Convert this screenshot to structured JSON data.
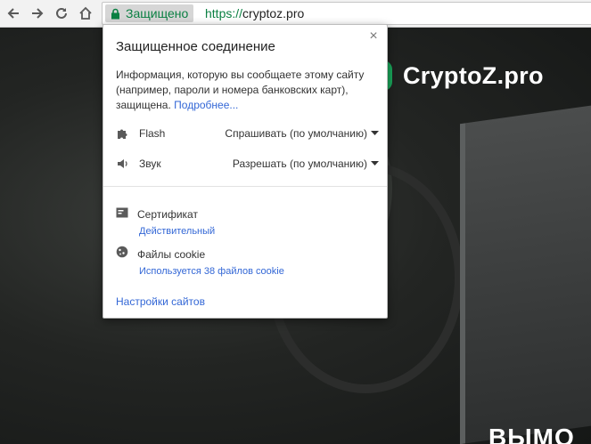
{
  "toolbar": {
    "secure_label": "Защищено",
    "url_scheme": "https://",
    "url_host": "cryptoz.pro"
  },
  "page": {
    "logo_text": "CryptoZ.pro",
    "hero_text": "ВЫМО"
  },
  "popup": {
    "title": "Защищенное соединение",
    "close_glyph": "×",
    "description": "Информация, которую вы сообщаете этому сайту (например, пароли и номера банковских карт), защищена.",
    "more_link": "Подробнее...",
    "permissions": [
      {
        "name": "Flash",
        "value": "Спрашивать (по умолчанию)"
      },
      {
        "name": "Звук",
        "value": "Разрешать (по умолчанию)"
      }
    ],
    "certificate": {
      "label": "Сертификат",
      "status": "Действительный"
    },
    "cookies": {
      "label": "Файлы cookie",
      "status": "Используется 38 файлов cookie"
    },
    "site_settings": "Настройки сайтов"
  },
  "colors": {
    "secure_green": "#0b8043",
    "link_blue": "#3367d6",
    "logo_green": "#19a55a"
  }
}
